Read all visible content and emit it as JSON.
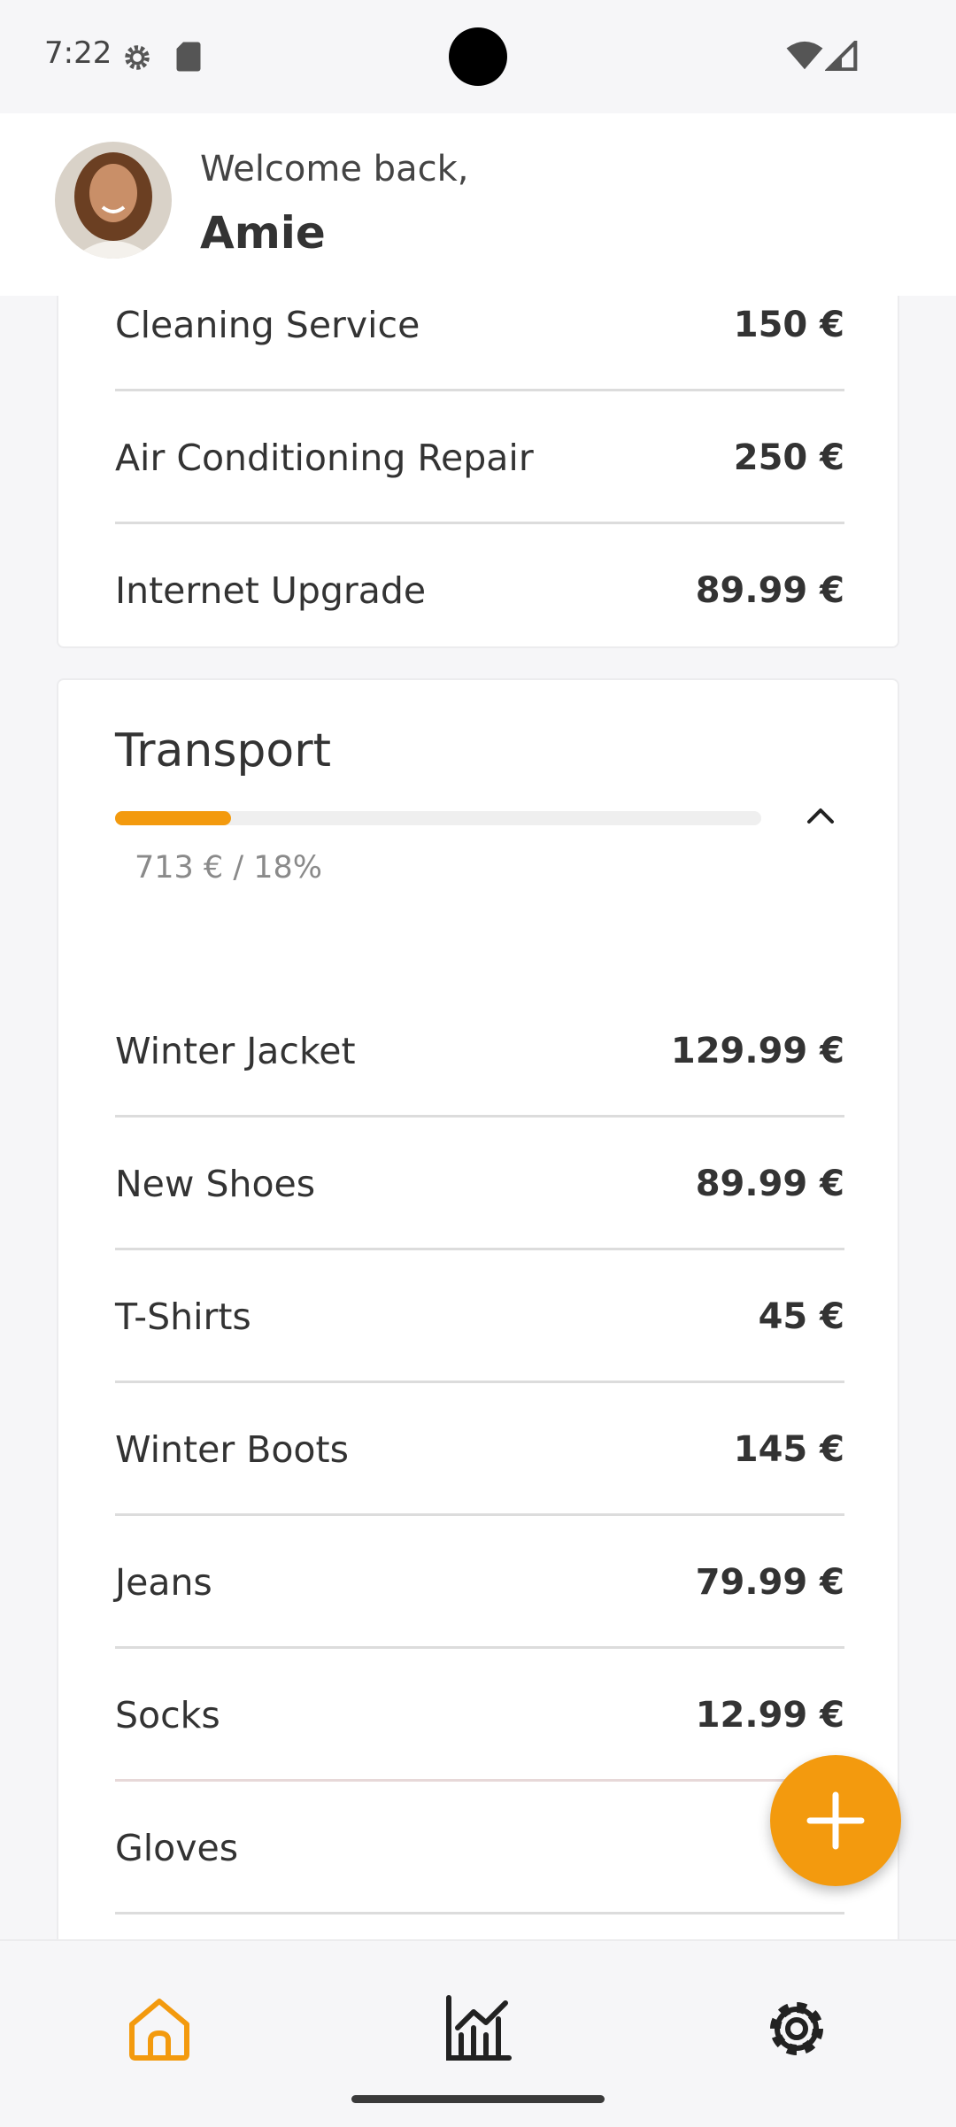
{
  "status_bar": {
    "time": "7:22"
  },
  "header": {
    "welcome": "Welcome back,",
    "name": "Amie"
  },
  "top_card": {
    "items": [
      {
        "name": "Cleaning Service",
        "amount": "150 €"
      },
      {
        "name": "Air Conditioning Repair",
        "amount": "250 €"
      },
      {
        "name": "Internet Upgrade",
        "amount": "89.99 €"
      }
    ]
  },
  "transport": {
    "title": "Transport",
    "summary": "713 € / 18%",
    "progress": 0.18,
    "accent": "#f39a0e",
    "items": [
      {
        "name": "Winter Jacket",
        "amount": "129.99 €"
      },
      {
        "name": "New Shoes",
        "amount": "89.99 €"
      },
      {
        "name": "T-Shirts",
        "amount": "45 €"
      },
      {
        "name": "Winter Boots",
        "amount": "145 €"
      },
      {
        "name": "Jeans",
        "amount": "79.99 €"
      },
      {
        "name": "Socks",
        "amount": "12.99 €"
      },
      {
        "name": "Gloves",
        "amount": ""
      }
    ]
  },
  "icons": {
    "fab": "plus-icon",
    "nav": [
      "home-icon",
      "chart-icon",
      "gear-icon"
    ]
  }
}
